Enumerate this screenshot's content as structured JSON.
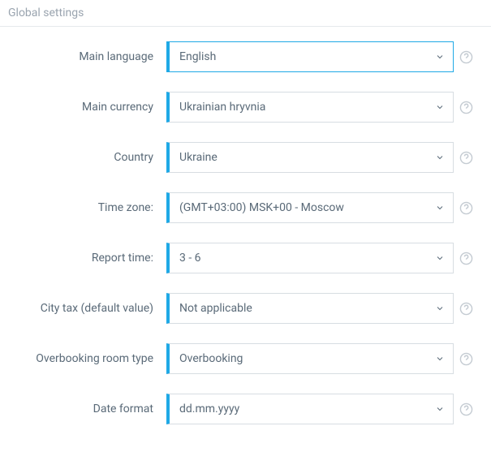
{
  "header": {
    "title": "Global settings"
  },
  "fields": {
    "main_language": {
      "label": "Main language",
      "value": "English"
    },
    "main_currency": {
      "label": "Main currency",
      "value": "Ukrainian hryvnia"
    },
    "country": {
      "label": "Country",
      "value": "Ukraine"
    },
    "time_zone": {
      "label": "Time zone:",
      "value": "(GMT+03:00) MSK+00 - Moscow"
    },
    "report_time": {
      "label": "Report time:",
      "value": "3 - 6"
    },
    "city_tax": {
      "label": "City tax (default value)",
      "value": "Not applicable"
    },
    "overbooking": {
      "label": "Overbooking room type",
      "value": "Overbooking"
    },
    "date_format": {
      "label": "Date format",
      "value": "dd.mm.yyyy"
    }
  },
  "colors": {
    "accent": "#1fa9e6",
    "text": "#5a6a78",
    "muted": "#9aa4af",
    "border": "#d7dde2",
    "help": "#c4cbd2"
  }
}
